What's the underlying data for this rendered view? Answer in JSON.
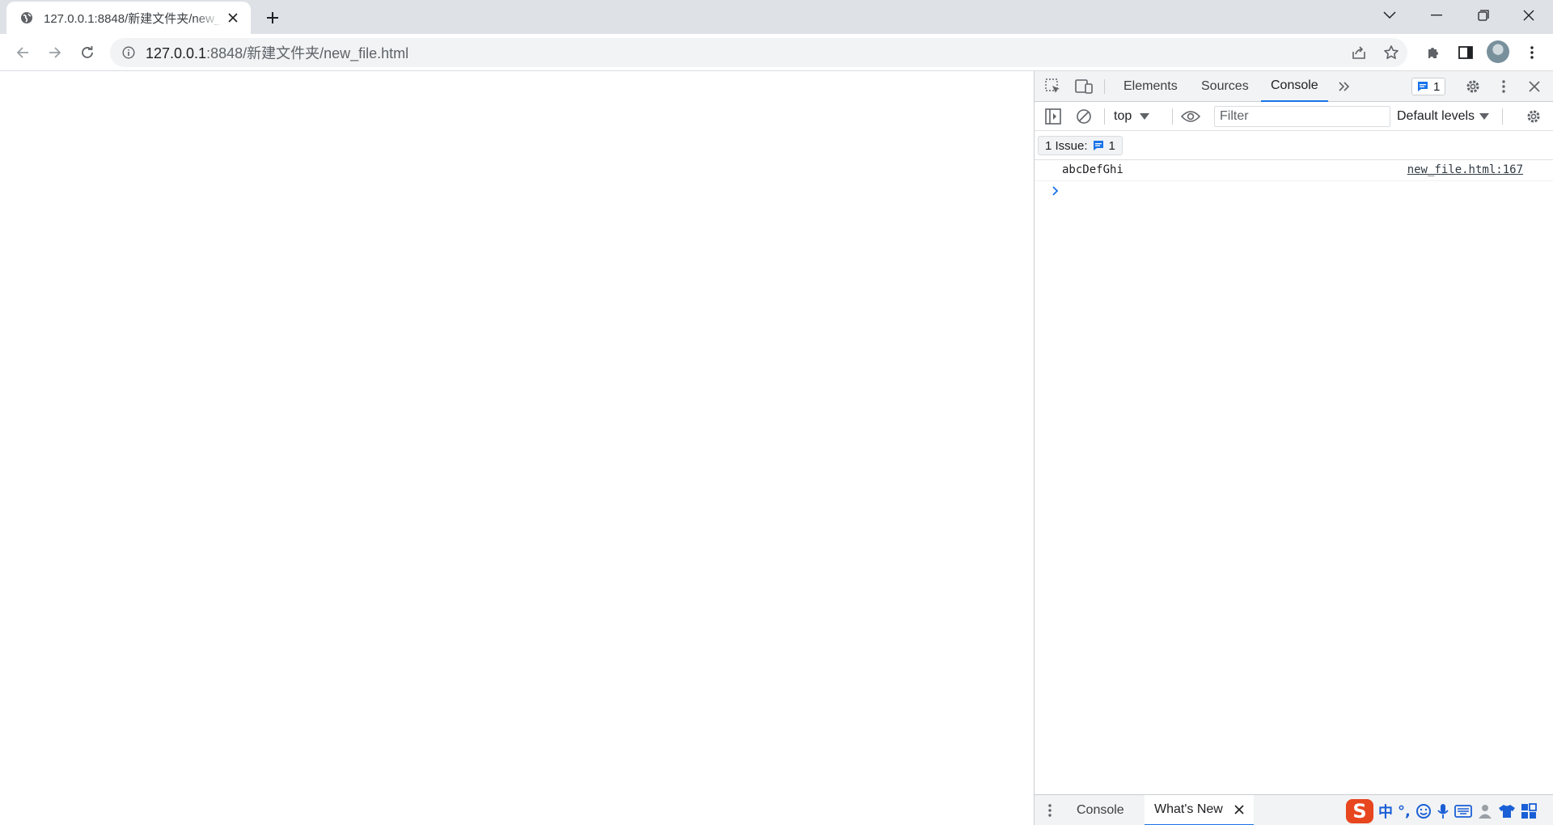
{
  "browser": {
    "tab": {
      "title": "127.0.0.1:8848/新建文件夹/new_file.html",
      "favicon": "globe-icon"
    },
    "address": {
      "host": "127.0.0.1",
      "path": ":8848/新建文件夹/new_file.html"
    }
  },
  "devtools": {
    "tabs": {
      "elements": "Elements",
      "sources": "Sources",
      "console": "Console"
    },
    "issues_count": "1",
    "toolbar": {
      "context": "top",
      "filter_placeholder": "Filter",
      "levels": "Default levels"
    },
    "issues_bar": {
      "label": "1 Issue:",
      "count": "1"
    },
    "messages": [
      {
        "text": "abcDefGhi",
        "source": "new_file.html:167"
      }
    ],
    "drawer": {
      "console": "Console",
      "whats_new": "What's New"
    }
  },
  "ime": {
    "chinese_mode": "中",
    "punct": "°,"
  },
  "colors": {
    "accent": "#1a73e8",
    "tabstrip": "#dee1e6",
    "ime_logo": "#e8461e"
  }
}
